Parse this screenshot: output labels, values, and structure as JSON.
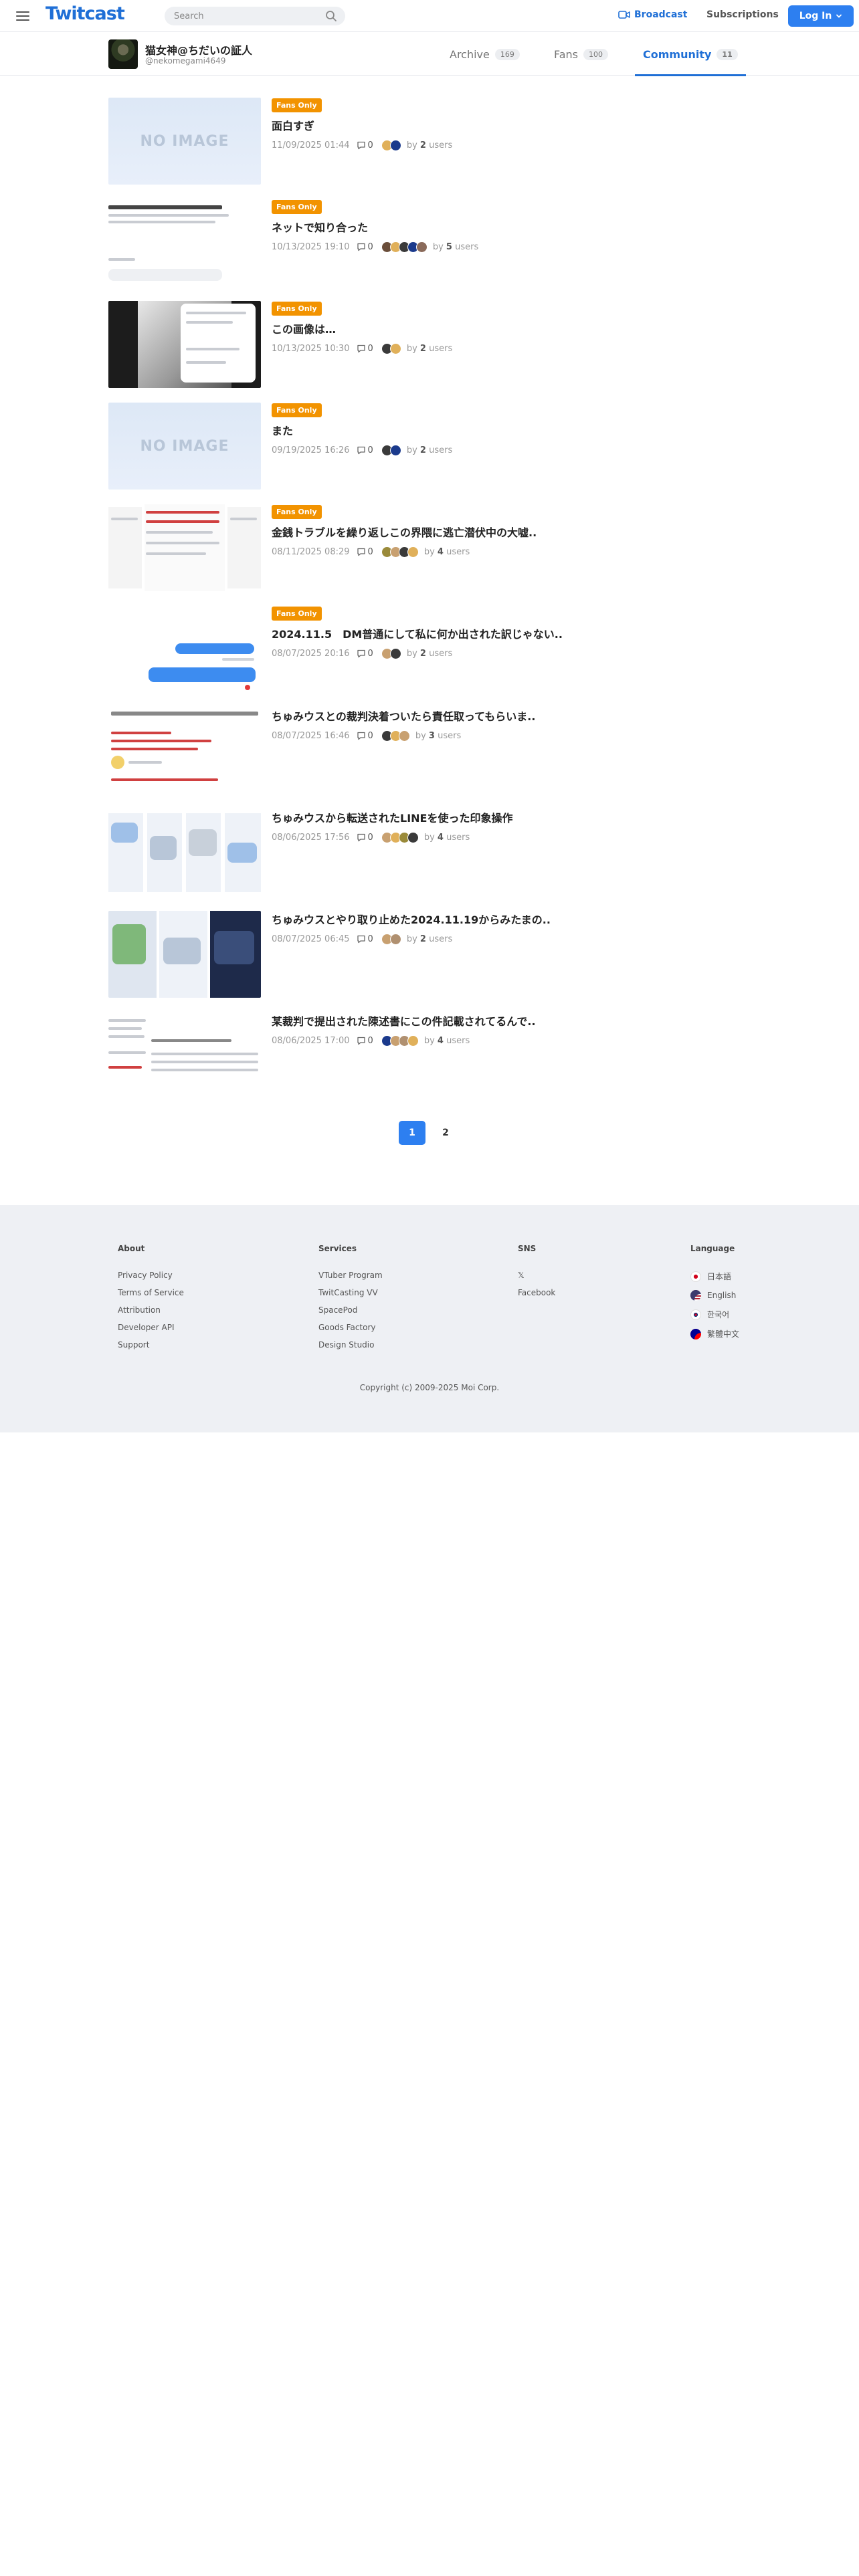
{
  "header": {
    "logo": "Twitcast",
    "search_placeholder": "Search",
    "broadcast": "Broadcast",
    "subscriptions": "Subscriptions",
    "login": "Log In",
    "accent": "#2d7ff0"
  },
  "profile": {
    "name": "猫女神@ちだいの証人",
    "handle": "@nekomegami4649",
    "tabs": [
      {
        "label": "Archive",
        "count": "169"
      },
      {
        "label": "Fans",
        "count": "100"
      },
      {
        "label": "Community",
        "count": "11"
      }
    ]
  },
  "posts": [
    {
      "badge": "Fans Only",
      "title": "面白すぎ",
      "date": "11/09/2025 01:44",
      "comments": "0",
      "users": "2",
      "thumb_text": "NO IMAGE"
    },
    {
      "badge": "Fans Only",
      "title": "ネットで知り合った",
      "date": "10/13/2025 19:10",
      "comments": "0",
      "users": "5"
    },
    {
      "badge": "Fans Only",
      "title": "この画像は…",
      "date": "10/13/2025 10:30",
      "comments": "0",
      "users": "2"
    },
    {
      "badge": "Fans Only",
      "title": "また",
      "date": "09/19/2025 16:26",
      "comments": "0",
      "users": "2",
      "thumb_text": "NO IMAGE"
    },
    {
      "badge": "Fans Only",
      "title": "金銭トラブルを繰り返しこの界隈に逃亡潜伏中の大嘘..",
      "date": "08/11/2025 08:29",
      "comments": "0",
      "users": "4"
    },
    {
      "badge": "Fans Only",
      "title": "2024.11.5　DM普通にして私に何か出された訳じゃない..",
      "date": "08/07/2025 20:16",
      "comments": "0",
      "users": "2"
    },
    {
      "title": "ちゅみウスとの裁判決着ついたら責任取ってもらいま..",
      "date": "08/07/2025 16:46",
      "comments": "0",
      "users": "3"
    },
    {
      "title": "ちゅみウスから転送されたLINEを使った印象操作",
      "date": "08/06/2025 17:56",
      "comments": "0",
      "users": "4"
    },
    {
      "title": "ちゅみウスとやり取り止めた2024.11.19からみたまの..",
      "date": "08/07/2025 06:45",
      "comments": "0",
      "users": "2"
    },
    {
      "title": "某裁判で提出された陳述書にこの件記載されてるんで..",
      "date": "08/06/2025 17:00",
      "comments": "0",
      "users": "4"
    }
  ],
  "by_label": "by",
  "users_label": "users",
  "pagination": [
    "1",
    "2"
  ],
  "footer": {
    "about": {
      "title": "About",
      "links": [
        "Privacy Policy",
        "Terms of Service",
        "Attribution",
        "Developer API",
        "Support"
      ]
    },
    "services": {
      "title": "Services",
      "links": [
        "VTuber Program",
        "TwitCasting VV",
        "SpacePod",
        "Goods Factory",
        "Design Studio"
      ]
    },
    "sns": {
      "title": "SNS",
      "links": [
        "𝕏",
        "Facebook"
      ]
    },
    "language": {
      "title": "Language",
      "links": [
        "日本語",
        "English",
        "한국어",
        "繁體中文"
      ]
    },
    "copyright": "Copyright (c) 2009-2025 Moi Corp."
  }
}
